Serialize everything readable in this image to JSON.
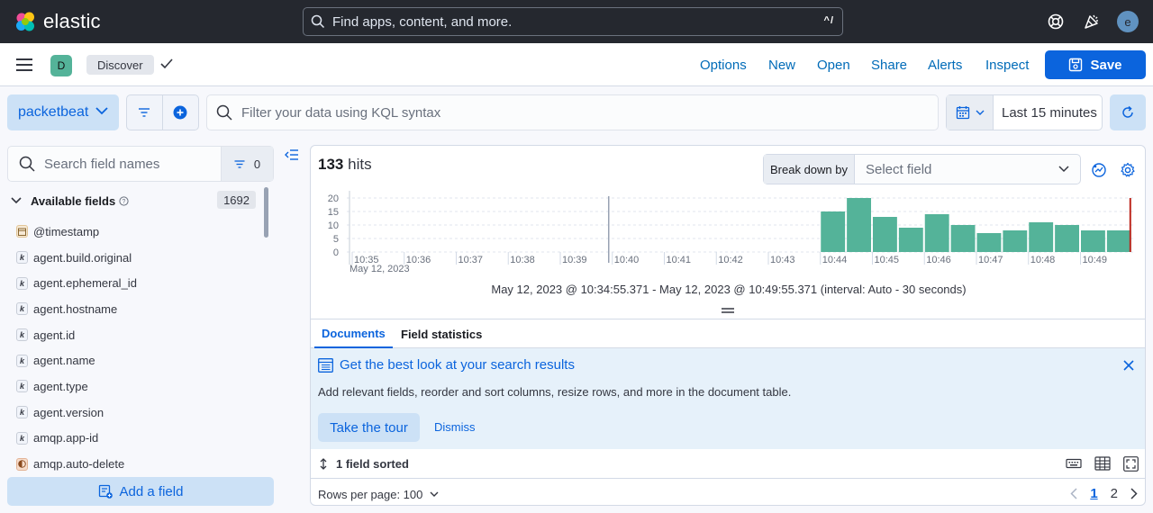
{
  "header": {
    "brand": "elastic",
    "search_placeholder": "Find apps, content, and more.",
    "search_shortcut": "^/",
    "avatar_initial": "e"
  },
  "appbar": {
    "space_initial": "D",
    "breadcrumb": "Discover",
    "links": [
      "Options",
      "New",
      "Open",
      "Share",
      "Alerts",
      "Inspect"
    ],
    "save_label": "Save"
  },
  "querybar": {
    "dataview": "packetbeat",
    "kql_placeholder": "Filter your data using KQL syntax",
    "time_range": "Last 15 minutes"
  },
  "sidebar": {
    "search_placeholder": "Search field names",
    "filter_count": "0",
    "available_title": "Available fields",
    "available_count": "1692",
    "fields": [
      {
        "name": "@timestamp",
        "type": "date"
      },
      {
        "name": "agent.build.original",
        "type": "k"
      },
      {
        "name": "agent.ephemeral_id",
        "type": "k"
      },
      {
        "name": "agent.hostname",
        "type": "k"
      },
      {
        "name": "agent.id",
        "type": "k"
      },
      {
        "name": "agent.name",
        "type": "k"
      },
      {
        "name": "agent.type",
        "type": "k"
      },
      {
        "name": "agent.version",
        "type": "k"
      },
      {
        "name": "amqp.app-id",
        "type": "k"
      },
      {
        "name": "amqp.auto-delete",
        "type": "boolean"
      }
    ],
    "add_field_label": "Add a field"
  },
  "main": {
    "hits_count": "133",
    "hits_label": "hits",
    "breakdown_label": "Break down by",
    "breakdown_placeholder": "Select field",
    "range_text": "May 12, 2023 @ 10:34:55.371 - May 12, 2023 @ 10:49:55.371 (interval: Auto - 30 seconds)",
    "tabs": [
      "Documents",
      "Field statistics"
    ],
    "callout": {
      "title": "Get the best look at your search results",
      "text": "Add relevant fields, reorder and sort columns, resize rows, and more in the document table.",
      "tour_label": "Take the tour",
      "dismiss_label": "Dismiss"
    },
    "sort_label": "1 field sorted",
    "rows_per_page": "Rows per page: 100",
    "pages": [
      "1",
      "2"
    ]
  },
  "colors": {
    "bar": "#54b399",
    "accent": "#0b64dd",
    "now_marker": "#bd271e",
    "topbar": "#25282f"
  },
  "chart_data": {
    "type": "bar",
    "y_ticks": [
      "20",
      "15",
      "10",
      "5",
      "0"
    ],
    "ylim": [
      0,
      20
    ],
    "x_ticks": [
      "10:35",
      "10:36",
      "10:37",
      "10:38",
      "10:39",
      "10:40",
      "10:41",
      "10:42",
      "10:43",
      "10:44",
      "10:45",
      "10:46",
      "10:47",
      "10:48",
      "10:49"
    ],
    "x_subtitle": "May 12, 2023",
    "interval_seconds": 30,
    "bars": [
      {
        "t": "10:44:00",
        "value": 15
      },
      {
        "t": "10:44:30",
        "value": 20
      },
      {
        "t": "10:45:00",
        "value": 13
      },
      {
        "t": "10:45:30",
        "value": 9
      },
      {
        "t": "10:46:00",
        "value": 14
      },
      {
        "t": "10:46:30",
        "value": 10
      },
      {
        "t": "10:47:00",
        "value": 7
      },
      {
        "t": "10:47:30",
        "value": 8
      },
      {
        "t": "10:48:00",
        "value": 11
      },
      {
        "t": "10:48:30",
        "value": 10
      },
      {
        "t": "10:49:00",
        "value": 8
      },
      {
        "t": "10:49:30",
        "value": 8
      }
    ]
  }
}
